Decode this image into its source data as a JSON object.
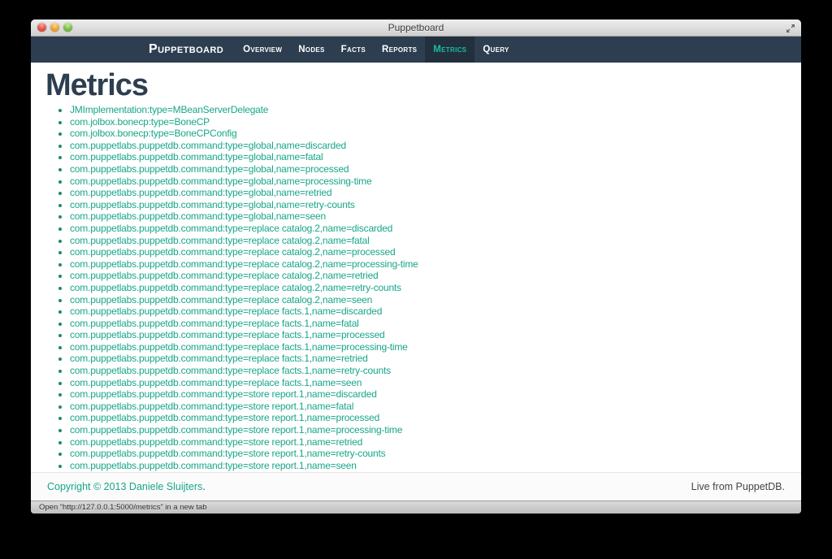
{
  "window": {
    "title": "Puppetboard",
    "controls": {
      "close": "close",
      "minimize": "minimize",
      "zoom": "zoom"
    },
    "fullscreen_icon": "expand-diagonal-arrows"
  },
  "navbar": {
    "brand": "Puppetboard",
    "items": [
      {
        "label": "Overview",
        "active": false
      },
      {
        "label": "Nodes",
        "active": false
      },
      {
        "label": "Facts",
        "active": false
      },
      {
        "label": "Reports",
        "active": false
      },
      {
        "label": "Metrics",
        "active": true
      },
      {
        "label": "Query",
        "active": false
      }
    ]
  },
  "page": {
    "heading": "Metrics",
    "metrics": [
      "JMImplementation:type=MBeanServerDelegate",
      "com.jolbox.bonecp:type=BoneCP",
      "com.jolbox.bonecp:type=BoneCPConfig",
      "com.puppetlabs.puppetdb.command:type=global,name=discarded",
      "com.puppetlabs.puppetdb.command:type=global,name=fatal",
      "com.puppetlabs.puppetdb.command:type=global,name=processed",
      "com.puppetlabs.puppetdb.command:type=global,name=processing-time",
      "com.puppetlabs.puppetdb.command:type=global,name=retried",
      "com.puppetlabs.puppetdb.command:type=global,name=retry-counts",
      "com.puppetlabs.puppetdb.command:type=global,name=seen",
      "com.puppetlabs.puppetdb.command:type=replace catalog.2,name=discarded",
      "com.puppetlabs.puppetdb.command:type=replace catalog.2,name=fatal",
      "com.puppetlabs.puppetdb.command:type=replace catalog.2,name=processed",
      "com.puppetlabs.puppetdb.command:type=replace catalog.2,name=processing-time",
      "com.puppetlabs.puppetdb.command:type=replace catalog.2,name=retried",
      "com.puppetlabs.puppetdb.command:type=replace catalog.2,name=retry-counts",
      "com.puppetlabs.puppetdb.command:type=replace catalog.2,name=seen",
      "com.puppetlabs.puppetdb.command:type=replace facts.1,name=discarded",
      "com.puppetlabs.puppetdb.command:type=replace facts.1,name=fatal",
      "com.puppetlabs.puppetdb.command:type=replace facts.1,name=processed",
      "com.puppetlabs.puppetdb.command:type=replace facts.1,name=processing-time",
      "com.puppetlabs.puppetdb.command:type=replace facts.1,name=retried",
      "com.puppetlabs.puppetdb.command:type=replace facts.1,name=retry-counts",
      "com.puppetlabs.puppetdb.command:type=replace facts.1,name=seen",
      "com.puppetlabs.puppetdb.command:type=store report.1,name=discarded",
      "com.puppetlabs.puppetdb.command:type=store report.1,name=fatal",
      "com.puppetlabs.puppetdb.command:type=store report.1,name=processed",
      "com.puppetlabs.puppetdb.command:type=store report.1,name=processing-time",
      "com.puppetlabs.puppetdb.command:type=store report.1,name=retried",
      "com.puppetlabs.puppetdb.command:type=store report.1,name=retry-counts",
      "com.puppetlabs.puppetdb.command:type=store report.1,name=seen"
    ]
  },
  "footer": {
    "copyright": "Copyright © 2013 Daniele Sluijters",
    "copyright_suffix": ".",
    "right": "Live from PuppetDB."
  },
  "statusbar": {
    "text": "Open “http://127.0.0.1:5000/metrics” in a new tab"
  },
  "colors": {
    "accent_teal": "#1abc9c",
    "link_teal": "#17a689",
    "navbar_bg": "#2d3e50",
    "navbar_active_bg": "#22303e",
    "heading": "#2c3e50"
  }
}
